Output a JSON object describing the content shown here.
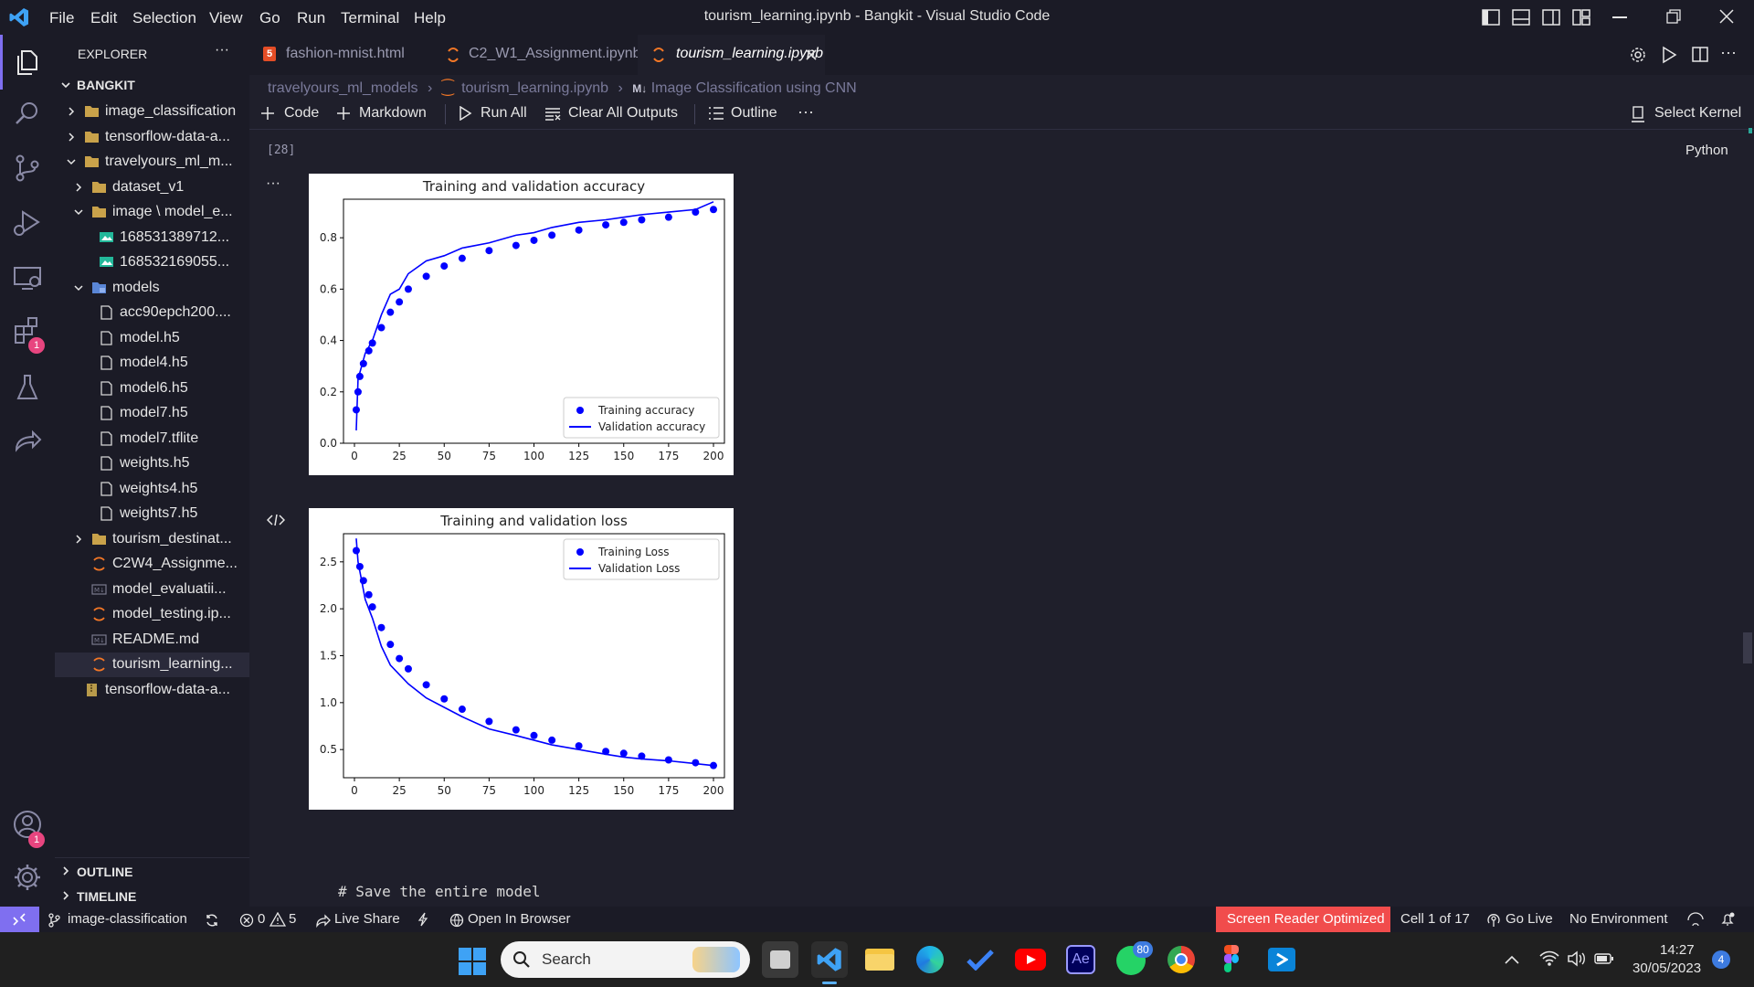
{
  "window": {
    "title": "tourism_learning.ipynb - Bangkit - Visual Studio Code",
    "menu": [
      "File",
      "Edit",
      "Selection",
      "View",
      "Go",
      "Run",
      "Terminal",
      "Help"
    ]
  },
  "activity_bar": {
    "icons": [
      "files-icon",
      "search-icon",
      "source-control-icon",
      "run-debug-icon",
      "remote-explorer-icon",
      "extensions-icon",
      "testing-icon",
      "live-share-icon",
      "accounts-icon",
      "settings-gear-icon"
    ],
    "extensions_badge": "1",
    "accounts_badge": "1"
  },
  "sidebar": {
    "header": "EXPLORER",
    "more": "···",
    "root": "BANGKIT",
    "items": [
      {
        "label": "image_classification",
        "depth": 0,
        "kind": "folder",
        "state": "collapsed"
      },
      {
        "label": "tensorflow-data-a...",
        "depth": 0,
        "kind": "folder",
        "state": "collapsed"
      },
      {
        "label": "travelyours_ml_m...",
        "depth": 0,
        "kind": "folder",
        "state": "expanded"
      },
      {
        "label": "dataset_v1",
        "depth": 1,
        "kind": "folder",
        "state": "collapsed"
      },
      {
        "label": "image \\ model_e...",
        "depth": 1,
        "kind": "folder",
        "state": "expanded"
      },
      {
        "label": "168531389712...",
        "depth": 2,
        "kind": "image"
      },
      {
        "label": "168532169055...",
        "depth": 2,
        "kind": "image"
      },
      {
        "label": "models",
        "depth": 1,
        "kind": "models-folder",
        "state": "expanded"
      },
      {
        "label": "acc90epch200....",
        "depth": 2,
        "kind": "file"
      },
      {
        "label": "model.h5",
        "depth": 2,
        "kind": "file"
      },
      {
        "label": "model4.h5",
        "depth": 2,
        "kind": "file"
      },
      {
        "label": "model6.h5",
        "depth": 2,
        "kind": "file"
      },
      {
        "label": "model7.h5",
        "depth": 2,
        "kind": "file"
      },
      {
        "label": "model7.tflite",
        "depth": 2,
        "kind": "file"
      },
      {
        "label": "weights.h5",
        "depth": 2,
        "kind": "file"
      },
      {
        "label": "weights4.h5",
        "depth": 2,
        "kind": "file"
      },
      {
        "label": "weights7.h5",
        "depth": 2,
        "kind": "file"
      },
      {
        "label": "tourism_destinat...",
        "depth": 1,
        "kind": "folder",
        "state": "collapsed"
      },
      {
        "label": "C2W4_Assignme...",
        "depth": 1,
        "kind": "notebook"
      },
      {
        "label": "model_evaluatii...",
        "depth": 1,
        "kind": "markdown"
      },
      {
        "label": "model_testing.ip...",
        "depth": 1,
        "kind": "notebook"
      },
      {
        "label": "README.md",
        "depth": 1,
        "kind": "markdown"
      },
      {
        "label": "tourism_learning...",
        "depth": 1,
        "kind": "notebook",
        "selected": true
      },
      {
        "label": "tensorflow-data-a...",
        "depth": 0,
        "kind": "zip"
      }
    ],
    "outline": "OUTLINE",
    "timeline": "TIMELINE"
  },
  "tabs": [
    {
      "label": "fashion-mnist.html",
      "icon": "html-icon",
      "active": false
    },
    {
      "label": "C2_W1_Assignment.ipynb",
      "icon": "notebook-icon",
      "active": false
    },
    {
      "label": "tourism_learning.ipynb",
      "icon": "notebook-icon",
      "active": true
    }
  ],
  "breadcrumb": [
    "travelyours_ml_models",
    "tourism_learning.ipynb",
    "Image Classification using CNN"
  ],
  "breadcrumb_md_marker": "M↓",
  "toolbar": {
    "code": "Code",
    "markdown": "Markdown",
    "run_all": "Run All",
    "clear_outputs": "Clear All Outputs",
    "outline": "Outline",
    "more": "···",
    "select_kernel": "Select Kernel"
  },
  "cell": {
    "execution_count": "[28]",
    "language": "Python",
    "output_more": "···",
    "next_cell_code": "# Save the entire model"
  },
  "chart_data": [
    {
      "type": "line",
      "title": "Training and validation accuracy",
      "xlim": [
        0,
        200
      ],
      "ylim": [
        0.0,
        0.95
      ],
      "xticks": [
        0,
        25,
        50,
        75,
        100,
        125,
        150,
        175,
        200
      ],
      "yticks": [
        0.0,
        0.2,
        0.4,
        0.6,
        0.8
      ],
      "legend_position": "lower-right",
      "series": [
        {
          "name": "Training accuracy",
          "style": "dots",
          "color": "#0000ff",
          "x": [
            1,
            2,
            3,
            5,
            8,
            10,
            15,
            20,
            25,
            30,
            40,
            50,
            60,
            75,
            90,
            100,
            110,
            125,
            140,
            150,
            160,
            175,
            190,
            200
          ],
          "y": [
            0.13,
            0.2,
            0.26,
            0.31,
            0.36,
            0.39,
            0.45,
            0.51,
            0.55,
            0.6,
            0.65,
            0.69,
            0.72,
            0.75,
            0.77,
            0.79,
            0.81,
            0.83,
            0.85,
            0.86,
            0.87,
            0.88,
            0.9,
            0.91
          ]
        },
        {
          "name": "Validation accuracy",
          "style": "line",
          "color": "#0000ff",
          "x": [
            1,
            2,
            4,
            6,
            10,
            15,
            20,
            25,
            30,
            40,
            50,
            60,
            75,
            90,
            100,
            110,
            125,
            140,
            150,
            160,
            175,
            190,
            200
          ],
          "y": [
            0.05,
            0.25,
            0.3,
            0.35,
            0.4,
            0.5,
            0.58,
            0.6,
            0.66,
            0.71,
            0.73,
            0.76,
            0.78,
            0.81,
            0.82,
            0.84,
            0.86,
            0.87,
            0.88,
            0.89,
            0.9,
            0.91,
            0.94
          ]
        }
      ]
    },
    {
      "type": "line",
      "title": "Training and validation loss",
      "xlim": [
        0,
        200
      ],
      "ylim": [
        0.2,
        2.8
      ],
      "xticks": [
        0,
        25,
        50,
        75,
        100,
        125,
        150,
        175,
        200
      ],
      "yticks": [
        0.5,
        1.0,
        1.5,
        2.0,
        2.5
      ],
      "legend_position": "upper-right",
      "series": [
        {
          "name": "Training Loss",
          "style": "dots",
          "color": "#0000ff",
          "x": [
            1,
            3,
            5,
            8,
            10,
            15,
            20,
            25,
            30,
            40,
            50,
            60,
            75,
            90,
            100,
            110,
            125,
            140,
            150,
            160,
            175,
            190,
            200
          ],
          "y": [
            2.62,
            2.45,
            2.3,
            2.15,
            2.02,
            1.8,
            1.62,
            1.47,
            1.36,
            1.19,
            1.04,
            0.93,
            0.8,
            0.71,
            0.65,
            0.6,
            0.54,
            0.48,
            0.46,
            0.43,
            0.39,
            0.36,
            0.33
          ]
        },
        {
          "name": "Validation Loss",
          "style": "line",
          "color": "#0000ff",
          "x": [
            1,
            2,
            4,
            6,
            10,
            15,
            20,
            25,
            30,
            40,
            50,
            60,
            75,
            90,
            100,
            110,
            125,
            140,
            150,
            160,
            175,
            190,
            200
          ],
          "y": [
            2.75,
            2.5,
            2.3,
            2.1,
            1.9,
            1.6,
            1.4,
            1.3,
            1.2,
            1.05,
            0.95,
            0.85,
            0.72,
            0.65,
            0.6,
            0.55,
            0.5,
            0.45,
            0.42,
            0.4,
            0.38,
            0.35,
            0.33
          ]
        }
      ]
    }
  ],
  "status_bar": {
    "branch": "image-classification",
    "errors": "0",
    "warnings": "5",
    "live_share": "Live Share",
    "open_browser": "Open In Browser",
    "screen_reader": "Screen Reader Optimized",
    "cell_position": "Cell 1 of 17",
    "go_live": "Go Live",
    "environment": "No Environment",
    "accent_color": "#f14c4c"
  },
  "taskbar": {
    "search_placeholder": "Search",
    "apps": [
      "start-icon",
      "search-icon",
      "task-view-icon",
      "vscode-icon",
      "file-explorer-icon",
      "edge-icon",
      "todo-icon",
      "youtube-icon",
      "after-effects-icon",
      "whatsapp-icon",
      "chrome-icon",
      "figma-icon",
      "remote-desktop-icon"
    ],
    "whatsapp_badge": "80",
    "ae_label": "Ae",
    "time": "14:27",
    "date": "30/05/2023",
    "notification_count": "4"
  }
}
